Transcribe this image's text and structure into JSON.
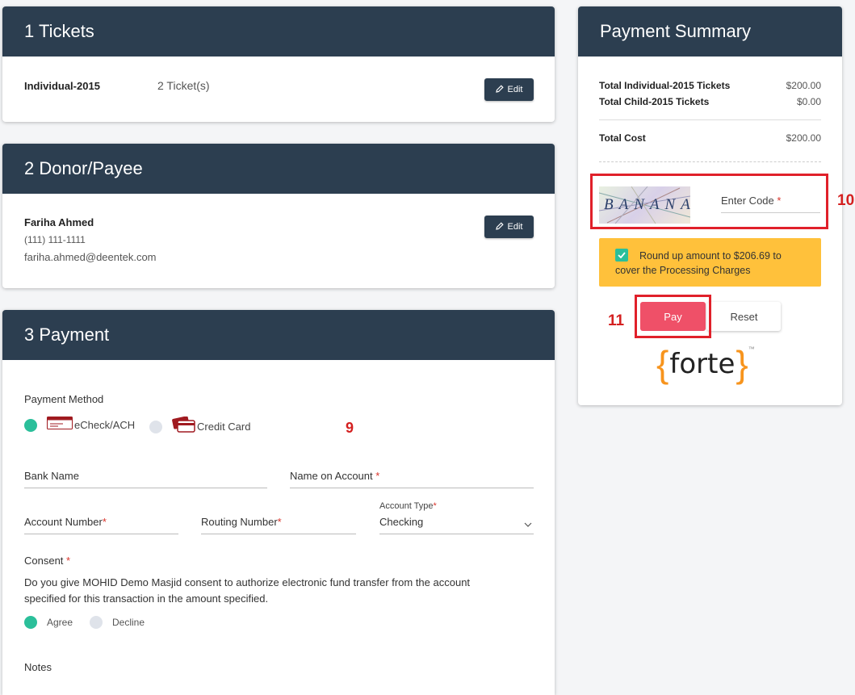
{
  "tickets": {
    "heading": "1 Tickets",
    "item_name": "Individual-2015",
    "item_qty": "2 Ticket(s)",
    "edit_label": "Edit"
  },
  "donor": {
    "heading": "2 Donor/Payee",
    "name": "Fariha Ahmed",
    "phone": "(111) 111-1111",
    "email": "fariha.ahmed@deentek.com",
    "edit_label": "Edit"
  },
  "payment": {
    "heading": "3 Payment",
    "method_label": "Payment Method",
    "methods": [
      {
        "label": "eCheck/ACH",
        "selected": true
      },
      {
        "label": "Credit Card",
        "selected": false
      }
    ],
    "annotation": "9",
    "bank_name": {
      "placeholder": "Bank Name"
    },
    "name_on_account": {
      "placeholder": "Name on Account",
      "required": "*"
    },
    "account_number": {
      "placeholder": "Account Number",
      "required": "*"
    },
    "routing_number": {
      "placeholder": "Routing Number",
      "required": "*"
    },
    "account_type": {
      "label": "Account Type",
      "required": "*",
      "value": "Checking"
    },
    "consent": {
      "label": "Consent",
      "required": "*",
      "text": "Do you give MOHID Demo Masjid consent to authorize electronic fund transfer from the account specified for this transaction in the amount specified.",
      "options": [
        {
          "label": "Agree",
          "selected": true
        },
        {
          "label": "Decline",
          "selected": false
        }
      ]
    },
    "notes_label": "Notes"
  },
  "summary": {
    "heading": "Payment Summary",
    "rows": [
      {
        "label": "Total Individual-2015 Tickets",
        "value": "$200.00"
      },
      {
        "label": "Total Child-2015 Tickets",
        "value": "$0.00"
      }
    ],
    "total": {
      "label": "Total Cost",
      "value": "$200.00"
    },
    "captcha_text": "BANANA",
    "code_placeholder": "Enter Code",
    "code_required": "*",
    "annotation_code": "10",
    "roundup_text": "Round up amount to $206.69 to cover the Processing Charges",
    "pay_label": "Pay",
    "reset_label": "Reset",
    "annotation_pay": "11",
    "logo_text": "forte",
    "logo_tm": "™"
  },
  "colors": {
    "header_bg": "#2c3e50",
    "radio_selected": "#2bbf9a",
    "pay_button": "#ef5068",
    "roundup_bg": "#ffc13b",
    "annotation_red": "#d42020",
    "forte_orange": "#f7941d"
  }
}
